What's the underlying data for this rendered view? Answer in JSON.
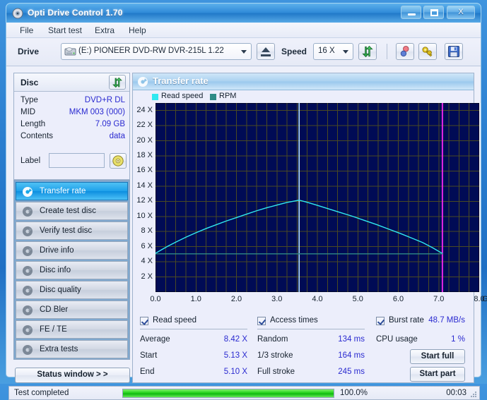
{
  "window": {
    "title": "Opti Drive Control 1.70",
    "icon": "disc-icon",
    "minimize_label": "_",
    "maximize_label": "□",
    "close_label": "X"
  },
  "menu": {
    "items": [
      {
        "label": "File",
        "name": "menu-file"
      },
      {
        "label": "Start test",
        "name": "menu-start-test"
      },
      {
        "label": "Extra",
        "name": "menu-extra"
      },
      {
        "label": "Help",
        "name": "menu-help"
      }
    ]
  },
  "toolbar": {
    "drive_label": "Drive",
    "drive_value": "(E:)  PIONEER DVD-RW  DVR-215L 1.22",
    "drive_icon": "drive-icon",
    "eject_icon": "eject-icon",
    "speed_label": "Speed",
    "speed_value": "16 X",
    "refresh_icon": "refresh-icon",
    "erase_icon": "erase-icon",
    "tools_icon": "tools-icon",
    "save_icon": "save-icon"
  },
  "disc": {
    "header": "Disc",
    "refresh_icon": "refresh-icon",
    "rows": [
      {
        "key": "Type",
        "value": "DVD+R DL"
      },
      {
        "key": "MID",
        "value": "MKM 003 (000)"
      },
      {
        "key": "Length",
        "value": "7.09 GB"
      },
      {
        "key": "Contents",
        "value": "data"
      }
    ],
    "label_key": "Label",
    "label_value": "",
    "label_placeholder": "",
    "label_button_icon": "disc-icon"
  },
  "sidebar": {
    "items": [
      {
        "label": "Transfer rate",
        "icon": "disc-icon",
        "selected": true
      },
      {
        "label": "Create test disc",
        "icon": "disc-icon",
        "selected": false
      },
      {
        "label": "Verify test disc",
        "icon": "disc-icon",
        "selected": false
      },
      {
        "label": "Drive info",
        "icon": "disc-icon",
        "selected": false
      },
      {
        "label": "Disc info",
        "icon": "disc-icon",
        "selected": false
      },
      {
        "label": "Disc quality",
        "icon": "disc-icon",
        "selected": false
      },
      {
        "label": "CD Bler",
        "icon": "disc-icon",
        "selected": false
      },
      {
        "label": "FE / TE",
        "icon": "disc-icon",
        "selected": false
      },
      {
        "label": "Extra tests",
        "icon": "disc-icon",
        "selected": false
      }
    ],
    "status_window_button": "Status window > >"
  },
  "panel": {
    "title": "Transfer rate",
    "icon": "disc-icon"
  },
  "chart_data": {
    "type": "line",
    "title": "Transfer rate",
    "xlabel": "GB",
    "ylabel": "X",
    "xlim": [
      0.0,
      8.0
    ],
    "ylim": [
      0,
      25
    ],
    "grid": true,
    "legend_position": "top-left",
    "plot_bg": "#000b55",
    "grid_color": "#4a4a22",
    "xticks": [
      "0.0",
      "1.0",
      "2.0",
      "3.0",
      "4.0",
      "5.0",
      "6.0",
      "7.0",
      "8.0"
    ],
    "xtick_values": [
      0,
      1,
      2,
      3,
      4,
      5,
      6,
      7,
      8
    ],
    "x_unit": "GB",
    "yticks": [
      "2 X",
      "4 X",
      "6 X",
      "8 X",
      "10 X",
      "12 X",
      "14 X",
      "16 X",
      "18 X",
      "20 X",
      "22 X",
      "24 X"
    ],
    "ytick_values": [
      2,
      4,
      6,
      8,
      10,
      12,
      14,
      16,
      18,
      20,
      22,
      24
    ],
    "legend": [
      {
        "name": "Read speed",
        "color": "#30e8f0"
      },
      {
        "name": "RPM",
        "color": "#2e8b86"
      }
    ],
    "markers": [
      {
        "name": "layer-break",
        "x": 3.55,
        "color": "#b9e8ff"
      },
      {
        "name": "disc-end",
        "x": 7.09,
        "color": "#e426e4"
      }
    ],
    "series": [
      {
        "name": "Read speed",
        "color": "#30e8f0",
        "x": [
          0.0,
          0.15,
          0.3,
          0.5,
          0.75,
          1.0,
          1.25,
          1.5,
          1.75,
          2.0,
          2.25,
          2.5,
          2.75,
          3.0,
          3.25,
          3.45,
          3.55,
          3.7,
          3.95,
          4.25,
          4.55,
          4.85,
          5.15,
          5.45,
          5.75,
          6.05,
          6.35,
          6.6,
          6.85,
          7.09
        ],
        "y": [
          5.13,
          5.6,
          6.05,
          6.6,
          7.25,
          7.85,
          8.4,
          8.9,
          9.4,
          9.85,
          10.3,
          10.75,
          11.15,
          11.5,
          11.85,
          12.05,
          12.15,
          11.95,
          11.55,
          11.05,
          10.55,
          10.05,
          9.5,
          8.95,
          8.35,
          7.75,
          7.1,
          6.55,
          5.85,
          5.1
        ]
      },
      {
        "name": "RPM",
        "color": "#2e8b86",
        "x": [
          0.0,
          1.0,
          2.0,
          3.0,
          3.55,
          4.0,
          5.0,
          6.0,
          7.09
        ],
        "y": [
          5.05,
          5.05,
          5.05,
          5.05,
          5.05,
          5.05,
          5.05,
          5.05,
          5.05
        ]
      }
    ]
  },
  "stats": {
    "read_speed": {
      "title": "Read speed",
      "checked": true,
      "rows": [
        {
          "key": "Average",
          "value": "8.42 X"
        },
        {
          "key": "Start",
          "value": "5.13 X"
        },
        {
          "key": "End",
          "value": "5.10 X"
        }
      ]
    },
    "access_times": {
      "title": "Access times",
      "checked": true,
      "rows": [
        {
          "key": "Random",
          "value": "134 ms"
        },
        {
          "key": "1/3 stroke",
          "value": "164 ms"
        },
        {
          "key": "Full stroke",
          "value": "245 ms"
        }
      ]
    },
    "burst_rate": {
      "title": "Burst rate",
      "checked": true,
      "value": "48.7 MB/s",
      "rows": [
        {
          "key": "CPU usage",
          "value": "1 %"
        }
      ]
    },
    "buttons": [
      {
        "label": "Start full",
        "name": "start-full-button"
      },
      {
        "label": "Start part",
        "name": "start-part-button"
      }
    ]
  },
  "statusbar": {
    "message": "Test completed",
    "progress_percent": 100.0,
    "progress_text": "100.0%",
    "elapsed": "00:03"
  }
}
